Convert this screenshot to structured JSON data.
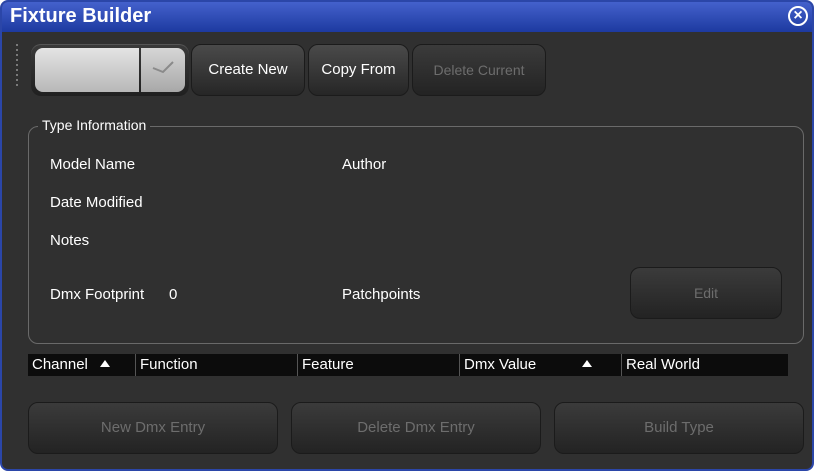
{
  "window": {
    "title": "Fixture Builder",
    "close_icon": "close-circle-icon"
  },
  "toolbar": {
    "create_new": "Create New",
    "copy_from": "Copy From",
    "delete_current": "Delete Current"
  },
  "type_information": {
    "legend": "Type Information",
    "model_name_label": "Model Name",
    "author_label": "Author",
    "date_modified_label": "Date Modified",
    "notes_label": "Notes",
    "dmx_footprint_label": "Dmx Footprint",
    "dmx_footprint_value": "0",
    "patchpoints_label": "Patchpoints",
    "edit_button": "Edit"
  },
  "table": {
    "columns": [
      "Channel",
      "Function",
      "Feature",
      "Dmx Value",
      "Real World"
    ],
    "sort_columns": [
      "Channel",
      "Dmx Value"
    ]
  },
  "actions": {
    "new_dmx_entry": "New Dmx Entry",
    "delete_dmx_entry": "Delete Dmx Entry",
    "build_type": "Build Type"
  },
  "colors": {
    "title_bar": "#2b46a8",
    "panel": "#303030",
    "text": "#ffffff",
    "disabled_text": "#6d6d6d"
  }
}
